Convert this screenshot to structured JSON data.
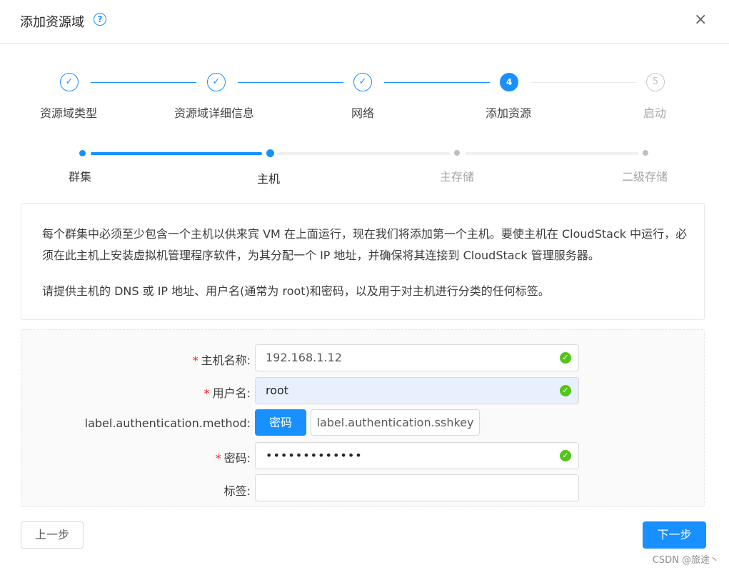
{
  "dialog": {
    "title": "添加资源域",
    "help_icon": "question-circle-icon",
    "close_icon": "close-icon",
    "close_glyph": "×"
  },
  "steps": [
    {
      "label": "资源域类型",
      "status": "done",
      "glyph": "✓"
    },
    {
      "label": "资源域详细信息",
      "status": "done",
      "glyph": "✓"
    },
    {
      "label": "网络",
      "status": "done",
      "glyph": "✓"
    },
    {
      "label": "添加资源",
      "status": "active",
      "glyph": "4"
    },
    {
      "label": "启动",
      "status": "wait",
      "glyph": "5"
    }
  ],
  "substeps": [
    {
      "label": "群集",
      "status": "done"
    },
    {
      "label": "主机",
      "status": "active"
    },
    {
      "label": "主存储",
      "status": "wait"
    },
    {
      "label": "二级存储",
      "status": "wait"
    }
  ],
  "info": {
    "paragraph1": "每个群集中必须至少包含一个主机以供来宾 VM 在上面运行，现在我们将添加第一个主机。要使主机在 CloudStack 中运行，必须在此主机上安装虚拟机管理程序软件，为其分配一个 IP 地址，并确保将其连接到 CloudStack 管理服务器。",
    "paragraph2": "请提供主机的 DNS 或 IP 地址、用户名(通常为 root)和密码，以及用于对主机进行分类的任何标签。"
  },
  "form": {
    "hostname": {
      "label": "主机名称",
      "value": "192.168.1.12",
      "required": true
    },
    "username": {
      "label": "用户名",
      "value": "root",
      "required": true
    },
    "auth_method": {
      "label": "label.authentication.method",
      "options": [
        "密码",
        "label.authentication.sshkey"
      ],
      "selected": "密码"
    },
    "password": {
      "label": "密码",
      "value": "•••••••••••••",
      "required": true
    },
    "tags": {
      "label": "标签",
      "value": ""
    },
    "required_mark": "*",
    "colon": ":",
    "valid_glyph": "✓"
  },
  "footer": {
    "prev_label": "上一步",
    "next_label": "下一步"
  },
  "watermark": "CSDN @旅途丶",
  "colors": {
    "primary": "#1890ff",
    "success": "#52c41a",
    "required": "#f5222d"
  }
}
